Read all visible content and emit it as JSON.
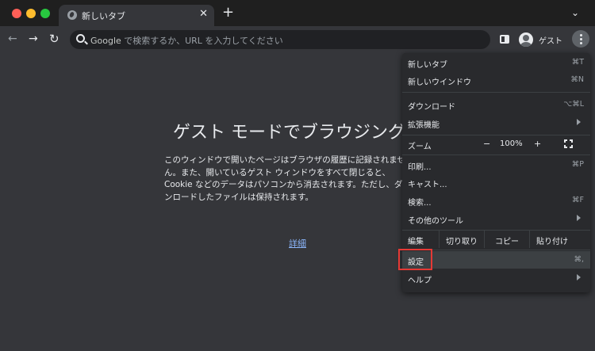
{
  "tab": {
    "title": "新しいタブ",
    "close": "✕"
  },
  "newtab": "+",
  "tabsearch": "⌄",
  "nav": {
    "back": "←",
    "forward": "→",
    "reload": "↻"
  },
  "omnibox": {
    "google": "Google",
    "placeholder": " で検索するか、URL を入力してください"
  },
  "profile": {
    "label": "ゲスト"
  },
  "page": {
    "heading": "ゲスト モードでブラウジング中",
    "lines": [
      "このウィンドウで開いたページはブラウザの履歴に記録されませ",
      "ん。また、開いているゲスト ウィンドウをすべて閉じると、",
      "Cookie などのデータはパソコンから消去されます。ただし、ダウ",
      "ンロードしたファイルは保持されます。"
    ],
    "details": "詳細"
  },
  "menu": {
    "new_tab": {
      "label": "新しいタブ",
      "shortcut": "⌘T"
    },
    "new_window": {
      "label": "新しいウインドウ",
      "shortcut": "⌘N"
    },
    "downloads": {
      "label": "ダウンロード",
      "shortcut": "⌥⌘L"
    },
    "extensions": {
      "label": "拡張機能"
    },
    "zoom": {
      "label": "ズーム",
      "minus": "−",
      "value": "100%",
      "plus": "+"
    },
    "print": {
      "label": "印刷...",
      "shortcut": "⌘P"
    },
    "cast": {
      "label": "キャスト..."
    },
    "find": {
      "label": "検索...",
      "shortcut": "⌘F"
    },
    "more_tools": {
      "label": "その他のツール"
    },
    "edit": {
      "label": "編集",
      "cut": "切り取り",
      "copy": "コピー",
      "paste": "貼り付け"
    },
    "settings": {
      "label": "設定",
      "shortcut": "⌘,"
    },
    "help": {
      "label": "ヘルプ"
    }
  }
}
